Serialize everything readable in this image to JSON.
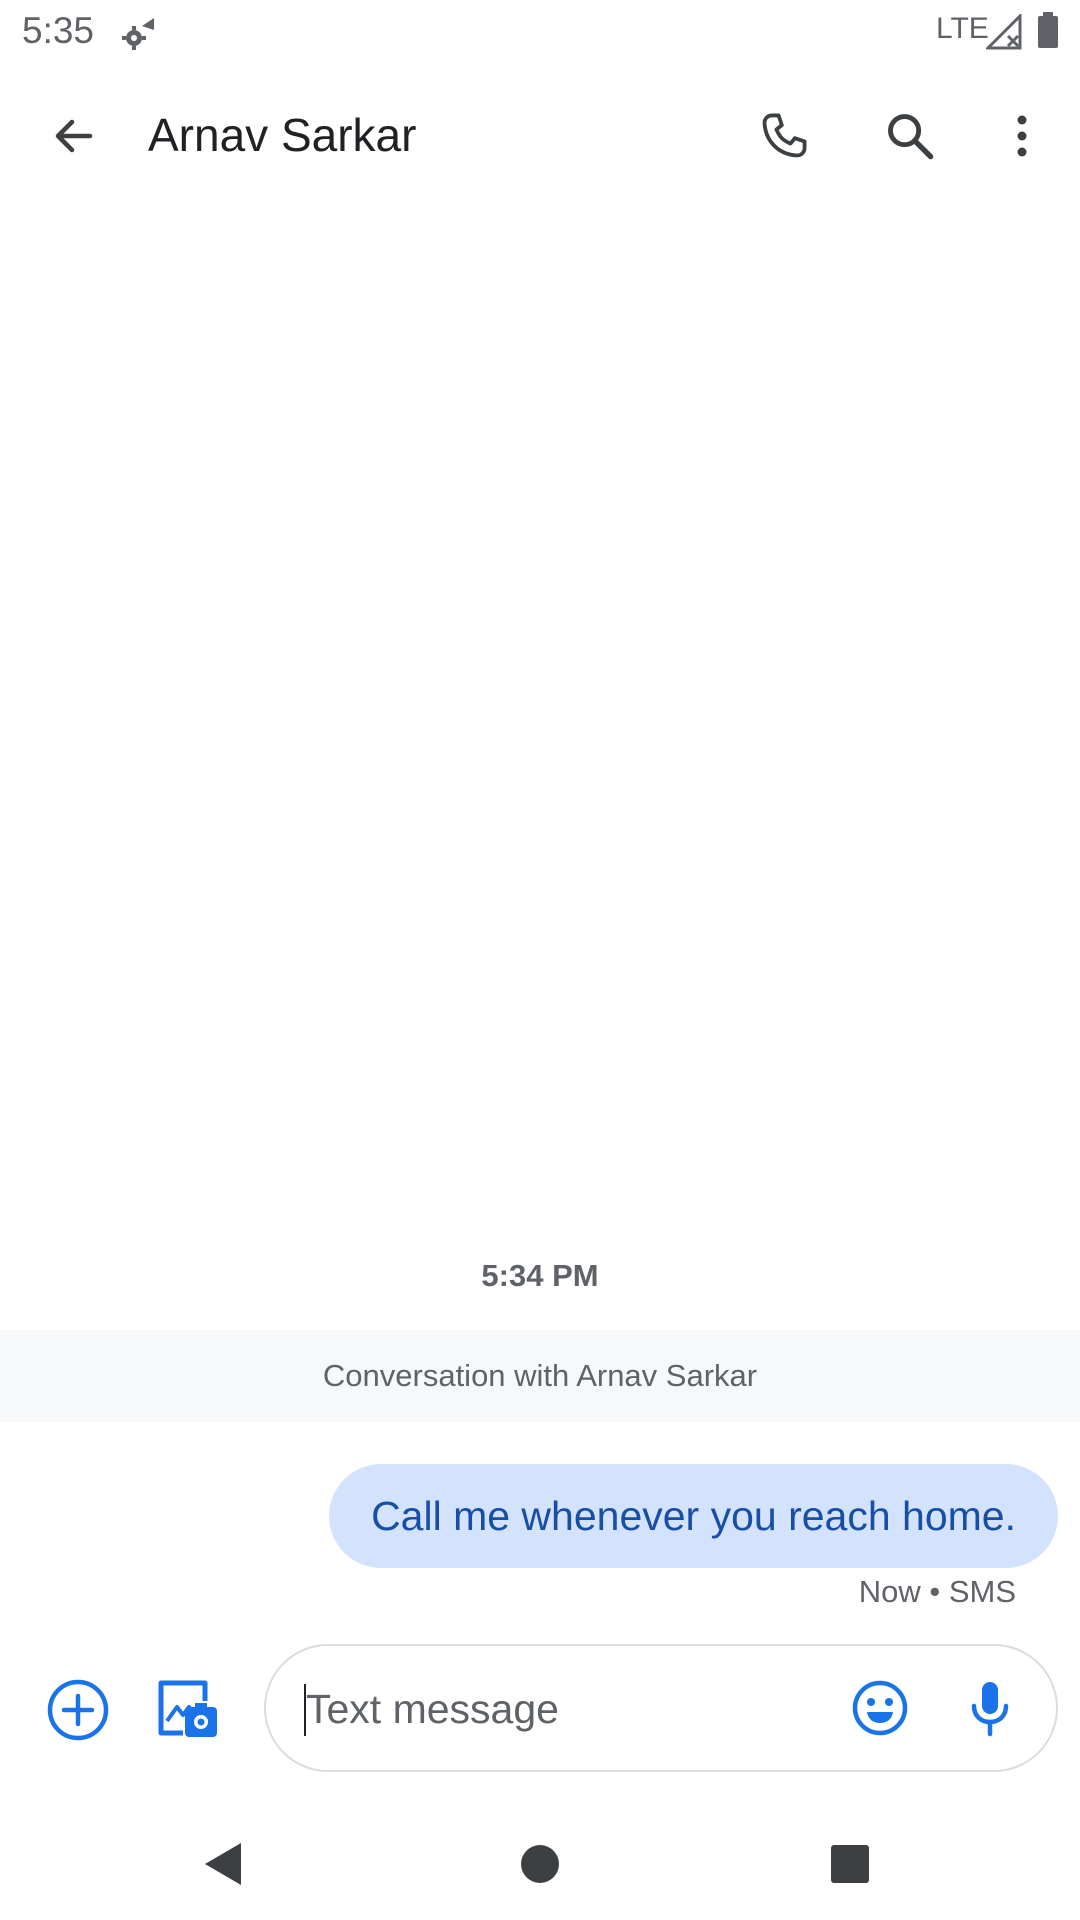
{
  "status_bar": {
    "time": "5:35",
    "network": "LTE"
  },
  "app_bar": {
    "title": "Arnav Sarkar"
  },
  "conversation": {
    "timestamp": "5:34 PM",
    "banner": "Conversation with Arnav Sarkar",
    "messages": [
      {
        "text": "Call me whenever you reach home.",
        "meta": "Now • SMS",
        "direction": "outgoing"
      }
    ]
  },
  "compose": {
    "placeholder": "Text message",
    "value": ""
  },
  "colors": {
    "accent": "#1a73e8",
    "bubble_bg": "#d3e3fd",
    "bubble_text": "#174ea6",
    "icon_gray": "#3c4043"
  },
  "icons": {
    "status": [
      "settings-sync-icon",
      "signal-icon",
      "battery-icon"
    ],
    "app_bar": [
      "back-arrow-icon",
      "phone-icon",
      "search-icon",
      "more-vert-icon"
    ],
    "compose": [
      "add-circle-icon",
      "gallery-camera-icon",
      "emoji-icon",
      "mic-icon"
    ],
    "nav": [
      "nav-back-icon",
      "nav-home-icon",
      "nav-recents-icon"
    ]
  }
}
